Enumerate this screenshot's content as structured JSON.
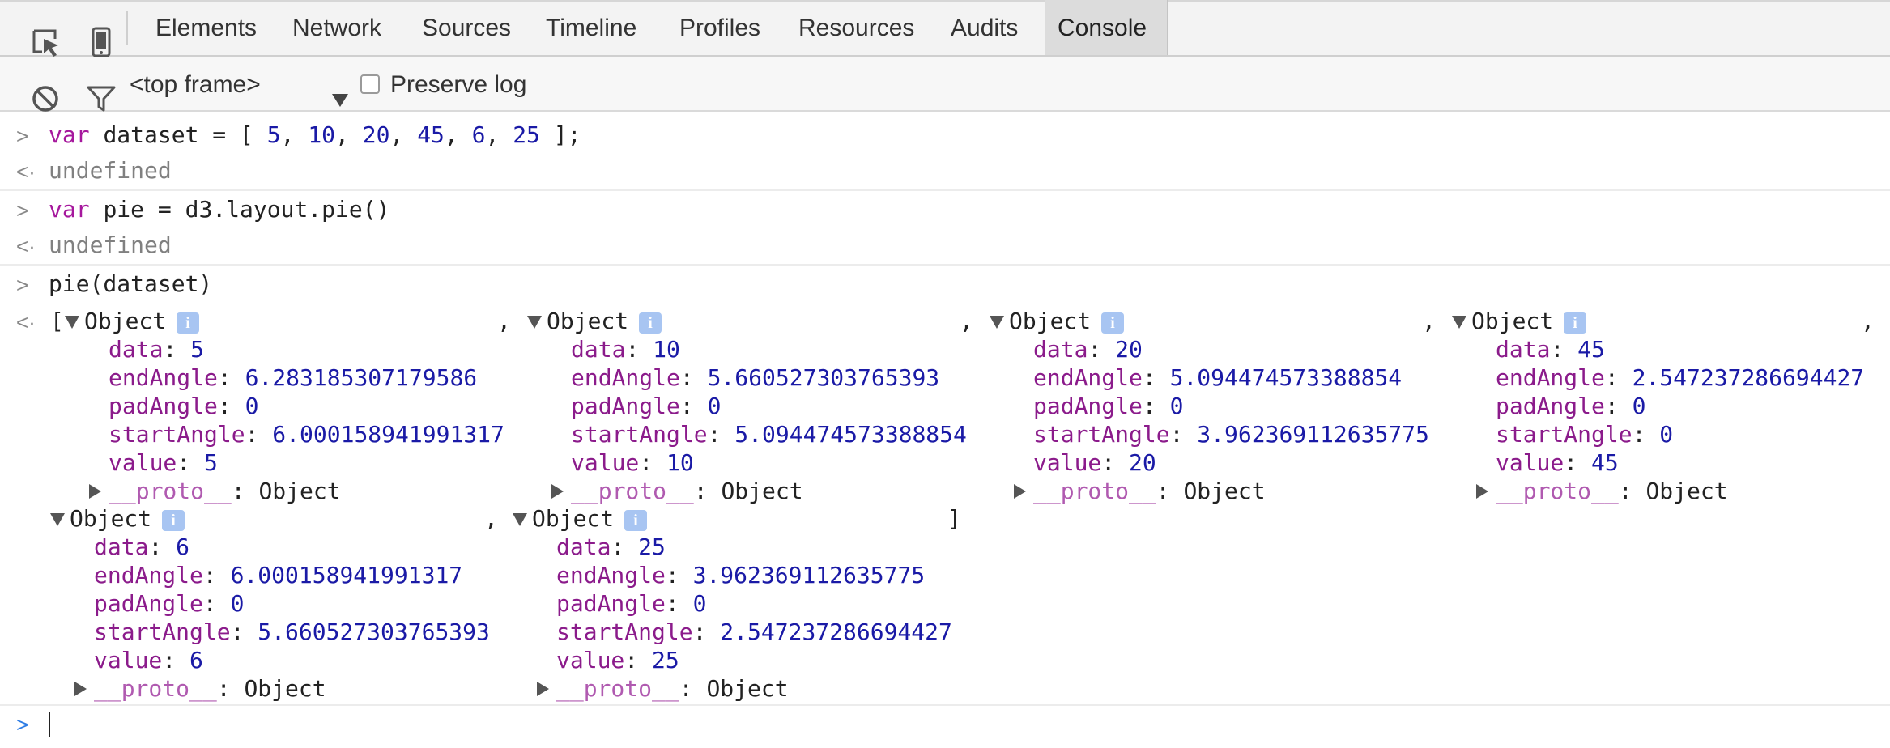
{
  "tabs": {
    "items": [
      "Elements",
      "Network",
      "Sources",
      "Timeline",
      "Profiles",
      "Resources",
      "Audits",
      "Console"
    ],
    "active": "Console"
  },
  "toolbar": {
    "frame_select": "<top frame>",
    "preserve_log_label": "Preserve log",
    "preserve_log_checked": false
  },
  "entries": [
    {
      "input": "var dataset = [ 5, 10, 20, 45, 6, 25 ];",
      "input_keyword": "var",
      "input_code": "dataset = [ ",
      "input_nums": [
        "5",
        "10",
        "20",
        "45",
        "6",
        "25"
      ],
      "input_end": " ];",
      "output": "undefined"
    },
    {
      "input": "var pie = d3.layout.pie()",
      "input_keyword": "var",
      "input_code": "pie = d3.layout.pie()",
      "output": "undefined"
    },
    {
      "input": "pie(dataset)"
    }
  ],
  "result": {
    "open_bracket": "[",
    "close_bracket": "]",
    "separator": ",",
    "object_label": "Object",
    "info_icon": "i",
    "proto_label": "__proto__",
    "proto_value": "Object",
    "objects": [
      {
        "data": "5",
        "endAngle": "6.283185307179586",
        "padAngle": "0",
        "startAngle": "6.000158941991317",
        "value": "5"
      },
      {
        "data": "10",
        "endAngle": "5.660527303765393",
        "padAngle": "0",
        "startAngle": "5.094474573388854",
        "value": "10"
      },
      {
        "data": "20",
        "endAngle": "5.094474573388854",
        "padAngle": "0",
        "startAngle": "3.962369112635775",
        "value": "20"
      },
      {
        "data": "45",
        "endAngle": "2.547237286694427",
        "padAngle": "0",
        "startAngle": "0",
        "value": "45"
      },
      {
        "data": "6",
        "endAngle": "6.000158941991317",
        "padAngle": "0",
        "startAngle": "5.660527303765393",
        "value": "6"
      },
      {
        "data": "25",
        "endAngle": "3.962369112635775",
        "padAngle": "0",
        "startAngle": "2.547237286694427",
        "value": "25"
      }
    ]
  },
  "icons": {
    "inspect": "inspect-element-icon",
    "device": "device-mode-icon",
    "clear": "clear-console-icon",
    "filter": "filter-icon",
    "dropdown": "dropdown-arrow-icon",
    "prompt": "prompt-chevron-icon",
    "result": "result-arrow-icon"
  },
  "colors": {
    "keyword": "#a6189d",
    "number": "#1a1aa6",
    "property": "#8b1b8b",
    "info_badge": "#a8c5f2",
    "prompt_active": "#2b7be5"
  }
}
